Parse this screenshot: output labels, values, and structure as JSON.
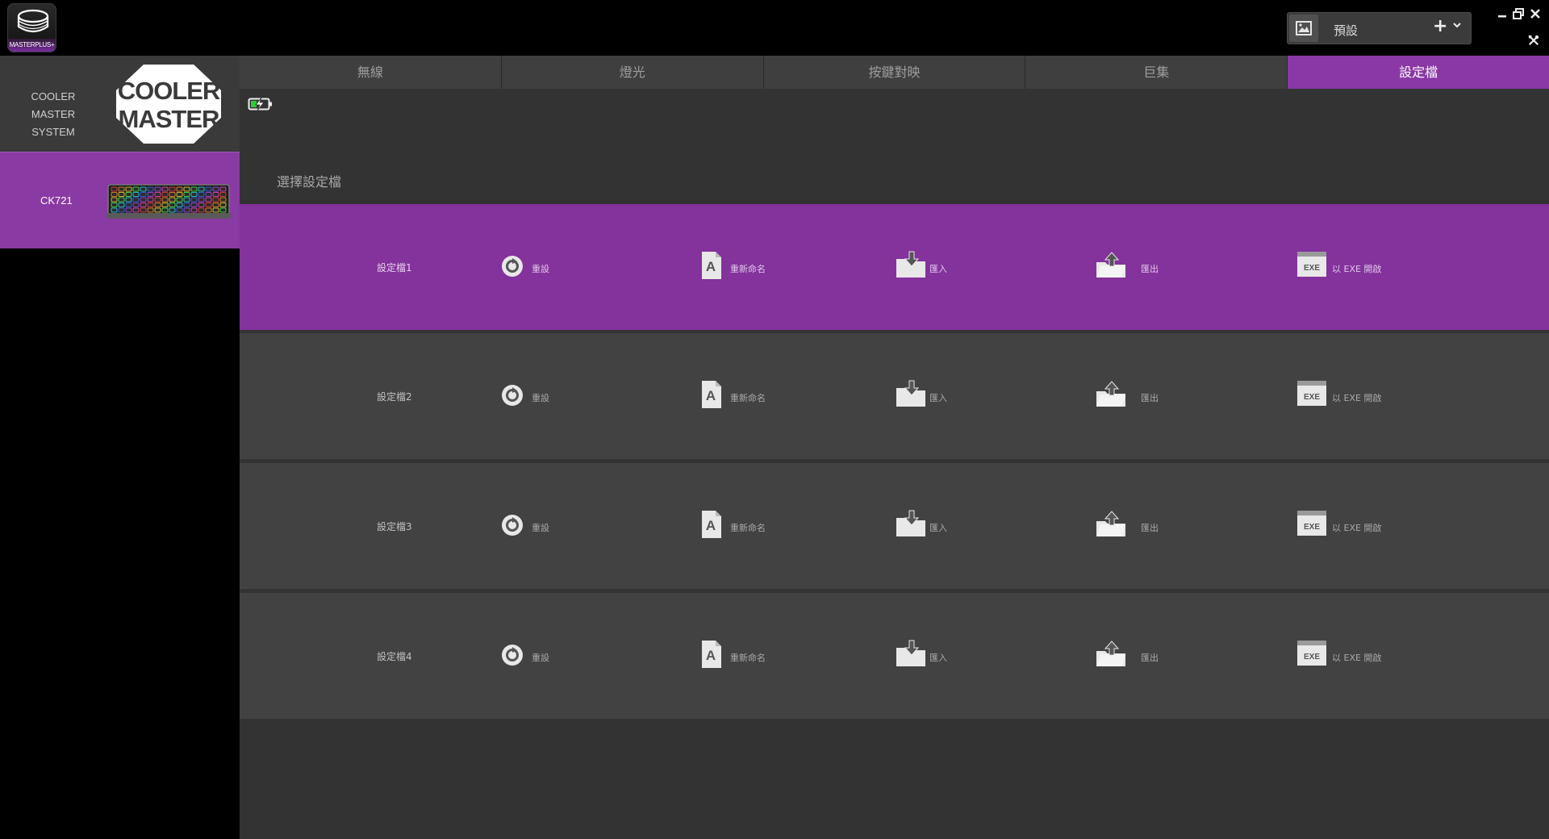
{
  "app": {
    "logo_text": "MASTERPLUS+"
  },
  "profile_selector": {
    "current": "預設"
  },
  "sidebar": {
    "brand_name": "COOLER MASTER SYSTEM",
    "brand_logo": "COOLER MASTER",
    "device": {
      "name": "CK721"
    }
  },
  "tabs": [
    {
      "label": "無線"
    },
    {
      "label": "燈光"
    },
    {
      "label": "按鍵對映"
    },
    {
      "label": "巨集"
    },
    {
      "label": "設定檔",
      "active": true
    }
  ],
  "section_label": "選擇設定檔",
  "action_labels": {
    "reset": "重設",
    "rename": "重新命名",
    "import": "匯入",
    "export": "匯出",
    "open_exe": "以 EXE 開啟",
    "exe_icon": "EXE"
  },
  "profiles": [
    {
      "name": "設定檔1",
      "selected": true
    },
    {
      "name": "設定檔2",
      "selected": false
    },
    {
      "name": "設定檔3",
      "selected": false
    },
    {
      "name": "設定檔4",
      "selected": false
    }
  ],
  "colors": {
    "accent": "#8a38a5",
    "row": "#424242",
    "background": "#333333"
  }
}
